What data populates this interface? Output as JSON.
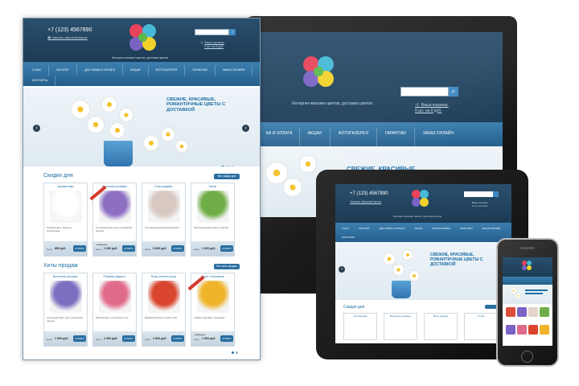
{
  "site": {
    "phone": "+7 (123) 4567890",
    "callback": "Заказать обратный звонок",
    "tagline": "Интернет-магазин цветов, доставка цветов",
    "cart_label": "Ваша корзина:",
    "cart_count": "0 шт. на 0 руб.",
    "search_icon": "search-icon",
    "nav": [
      "О НАС",
      "КАТАЛОГ",
      "ДОСТАВКА И ОПЛАТА",
      "АКЦИИ",
      "ФОТОГАЛЕРЕЯ",
      "ГАРАНТИИ",
      "ЗАКАЗ ОНЛАЙН",
      "КОНТАКТЫ"
    ],
    "slide_text": "СВЕЖИЕ, КРАСИВЫЕ, РОМАНТИЧНЫЕ ЦВЕТЫ С ДОСТАВКОЙ",
    "slider_prev": "‹",
    "slider_next": "›"
  },
  "monitor_nav": [
    "КА И ОПЛАТА",
    "АКЦИИ",
    "ФОТОГАЛЕРЕЯ",
    "ГАРАНТИИ",
    "ЗАКАЗ ОНЛАЙН"
  ],
  "monitor_slide_text": "СВЕЖИЕ, КРАСИВЫЕ, РОМАНТИЧНЫЕ ЦВЕТЫ С",
  "sections": {
    "deals": {
      "title": "Скидки дня",
      "all_button": "Все скидки дня",
      "cards": [
        {
          "title": "Хризантемы",
          "desc": "Ромашковые, букеты и хризантемы",
          "old": "",
          "price": "890 руб.",
          "color": "#ffffff"
        },
        {
          "title": "Весенние розовые",
          "desc": "Стильный букет для утонченной натуры",
          "old": "3 000 руб.",
          "price": "1 300 руб.",
          "color": "#8d6fc2"
        },
        {
          "title": "Розы ведьмы",
          "desc": "Стильный оригинальный букет",
          "old": "",
          "price": "6 800 руб.",
          "color": "#d7c8c2"
        },
        {
          "title": "Котик",
          "desc": "Оригинальный котик из цветов",
          "old": "",
          "price": "1 000 руб.",
          "color": "#6fae46"
        }
      ]
    },
    "hits": {
      "title": "Хиты продаж",
      "all_button": "Все хиты продаж",
      "cards": [
        {
          "title": "Весенние розовые",
          "desc": "Стильный букет для утонченной натуры",
          "old": "",
          "price": "1 500 руб.",
          "color": "#7a6fc0"
        },
        {
          "title": "Розовая радость",
          "desc": "Милый букет из розовых роз",
          "old": "",
          "price": "2 300 руб.",
          "color": "#e06a8a"
        },
        {
          "title": "Розы желтые-розы",
          "desc": "Шикарный букет из 101 розы",
          "old": "",
          "price": "2 500 руб.",
          "color": "#d9452f"
        },
        {
          "title": "Букет тюльпанов",
          "desc": "Самые красивые тюльпаны",
          "old": "4 000 руб.",
          "price": "1 900 руб.",
          "color": "#f0b42a"
        }
      ]
    }
  },
  "buy_label": "КУПИТЬ",
  "price_prefix": "Цена:",
  "tablet_section_title": "Скидки дня",
  "tablet_cards": [
    "Хризантемы",
    "Весенние розовые",
    "Розы ведьмы",
    "Котик"
  ],
  "colors": {
    "header": "#1c3b55",
    "nav": "#2f73a5",
    "accent": "#1d6fa6",
    "button": "#2a6fa0"
  }
}
